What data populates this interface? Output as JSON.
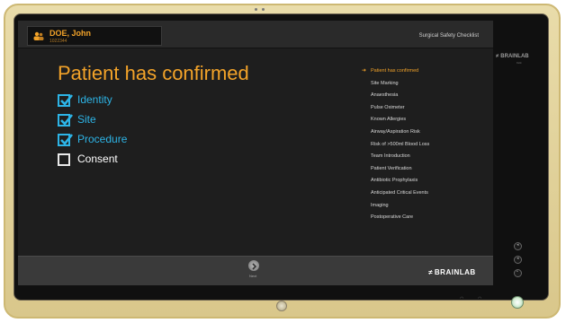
{
  "patient": {
    "name": "DOE, John",
    "id": "1022344"
  },
  "header": {
    "checklist_title": "Surgical Safety Checklist"
  },
  "main": {
    "title": "Patient has confirmed",
    "items": [
      {
        "label": "Identity",
        "checked": true
      },
      {
        "label": "Site",
        "checked": true
      },
      {
        "label": "Procedure",
        "checked": true
      },
      {
        "label": "Consent",
        "checked": false
      }
    ]
  },
  "nav": {
    "arrow": "➜",
    "items": [
      "Patient has confirmed",
      "Site Marking",
      "Anaesthesia",
      "Pulse Oximeter",
      "Known Allergies",
      "Airway/Aspiration Risk",
      "Risk of >500ml Blood Loss",
      "Team Introduction",
      "Patient Verification",
      "Antibiotic Prophylaxis",
      "Anticipated Critical Events",
      "Imaging",
      "Postoperative Care"
    ],
    "active_index": 0
  },
  "footer": {
    "next_label": "Next",
    "brand": "BRAINLAB"
  },
  "device": {
    "brand": "BRAINLAB",
    "sub": "Kick"
  },
  "icons": {
    "patient": "patient-icon",
    "check": "checkmark-icon",
    "next": "next-arrow-icon",
    "brand_mark": "brainlab-logo-icon"
  },
  "colors": {
    "accent_orange": "#f3a329",
    "check_blue": "#2db4e6",
    "screen_bg": "#1e1e1e",
    "bezel": "#e2d39a"
  }
}
